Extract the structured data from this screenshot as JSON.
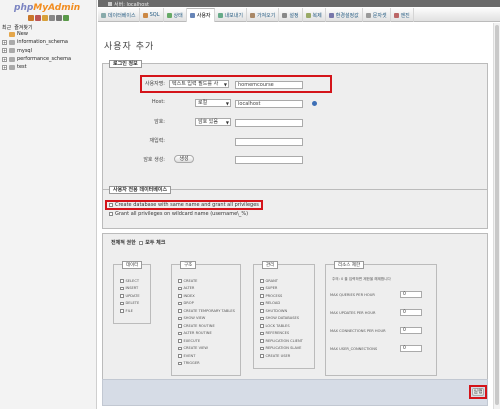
{
  "logo": {
    "part1": "php",
    "part2": "MyAdmin"
  },
  "nav": {
    "tab_recent": "최근",
    "tab_favorites": "즐겨찾기",
    "tree": [
      {
        "label": "New",
        "kind": "new"
      },
      {
        "label": "information_schema",
        "kind": "db"
      },
      {
        "label": "mysql",
        "kind": "db"
      },
      {
        "label": "performance_schema",
        "kind": "db"
      },
      {
        "label": "test",
        "kind": "db"
      }
    ]
  },
  "topbar": {
    "breadcrumb": "서버: localhost"
  },
  "menu": {
    "tabs": [
      {
        "label": "데이터베이스",
        "icon": "database-icon"
      },
      {
        "label": "SQL",
        "icon": "sql-icon"
      },
      {
        "label": "상태",
        "icon": "status-icon"
      },
      {
        "label": "사용자",
        "icon": "users-icon",
        "active": true
      },
      {
        "label": "내보내기",
        "icon": "export-icon"
      },
      {
        "label": "가져오기",
        "icon": "import-icon"
      },
      {
        "label": "설정",
        "icon": "settings-icon"
      },
      {
        "label": "복제",
        "icon": "replication-icon"
      },
      {
        "label": "환경설정값",
        "icon": "variables-icon"
      },
      {
        "label": "문자셋",
        "icon": "charset-icon"
      },
      {
        "label": "엔진",
        "icon": "engines-icon"
      }
    ]
  },
  "page": {
    "title": "사용자 추가"
  },
  "login": {
    "legend": "로그인 정보",
    "username_label": "사용자명:",
    "username_select": "텍스트 입력 필드를 사",
    "username_value": "homemcourse",
    "host_label": "Host:",
    "host_select": "로컬",
    "host_value": "localhost",
    "password_label": "암호:",
    "password_select": "암호 있음",
    "retype_label": "재입력:",
    "generate_label": "암호 생성:",
    "generate_button": "생성"
  },
  "database": {
    "legend": "사용자 전용 데이터베이스",
    "opt_create": "Create database with same name and grant all privileges",
    "opt_wildcard": "Grant all privileges on wildcard name (username\\_%)"
  },
  "global": {
    "legend": "전체적 권한",
    "check_all": "모두 체크",
    "data": {
      "title": "데이터",
      "items": [
        "SELECT",
        "INSERT",
        "UPDATE",
        "DELETE",
        "FILE"
      ]
    },
    "structure": {
      "title": "구조",
      "items": [
        "CREATE",
        "ALTER",
        "INDEX",
        "DROP",
        "CREATE TEMPORARY TABLES",
        "SHOW VIEW",
        "CREATE ROUTINE",
        "ALTER ROUTINE",
        "EXECUTE",
        "CREATE VIEW",
        "EVENT",
        "TRIGGER"
      ]
    },
    "admin": {
      "title": "관리",
      "items": [
        "GRANT",
        "SUPER",
        "PROCESS",
        "RELOAD",
        "SHUTDOWN",
        "SHOW DATABASES",
        "LOCK TABLES",
        "REFERENCES",
        "REPLICATION CLIENT",
        "REPLICATION SLAVE",
        "CREATE USER"
      ]
    },
    "limits": {
      "title": "리소스 제한",
      "note": "주의: 0 을 입력하면 제한을 해제합니다",
      "rows": [
        {
          "label": "MAX QUERIES PER HOUR",
          "value": "0"
        },
        {
          "label": "MAX UPDATES PER HOUR",
          "value": "0"
        },
        {
          "label": "MAX CONNECTIONS PER HOUR",
          "value": "0"
        },
        {
          "label": "MAX USER_CONNECTIONS",
          "value": "0"
        }
      ]
    }
  },
  "footer": {
    "submit": "실행"
  }
}
